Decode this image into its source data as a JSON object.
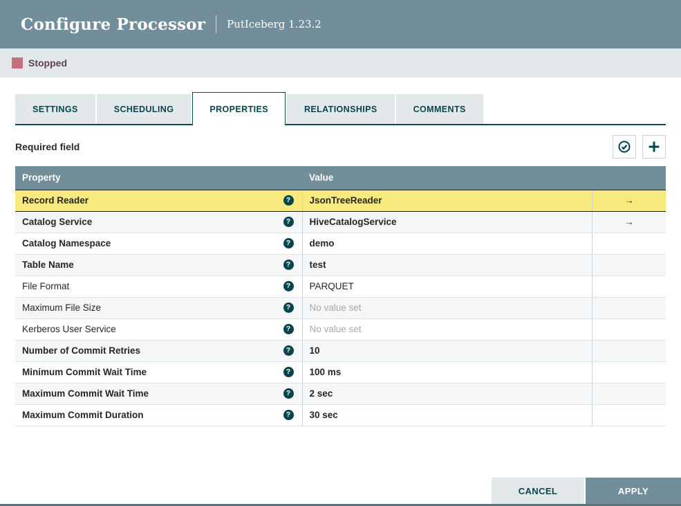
{
  "header": {
    "title": "Configure Processor",
    "subtitle": "PutIceberg 1.23.2"
  },
  "status": {
    "label": "Stopped",
    "color": "#c5707c"
  },
  "tabs": [
    {
      "label": "SETTINGS",
      "active": false
    },
    {
      "label": "SCHEDULING",
      "active": false
    },
    {
      "label": "PROPERTIES",
      "active": true
    },
    {
      "label": "RELATIONSHIPS",
      "active": false
    },
    {
      "label": "COMMENTS",
      "active": false
    }
  ],
  "toolbar": {
    "required_label": "Required field",
    "verify_icon": "check-circle-icon",
    "add_icon": "plus-icon"
  },
  "table": {
    "columns": [
      "Property",
      "Value"
    ],
    "help_icon_glyph": "?",
    "goto_arrow_glyph": "→",
    "rows": [
      {
        "property": "Record Reader",
        "value": "JsonTreeReader",
        "required": true,
        "selected": true,
        "goto": true,
        "no_value": false
      },
      {
        "property": "Catalog Service",
        "value": "HiveCatalogService",
        "required": true,
        "selected": false,
        "goto": true,
        "no_value": false
      },
      {
        "property": "Catalog Namespace",
        "value": "demo",
        "required": true,
        "selected": false,
        "goto": false,
        "no_value": false
      },
      {
        "property": "Table Name",
        "value": "test",
        "required": true,
        "selected": false,
        "goto": false,
        "no_value": false
      },
      {
        "property": "File Format",
        "value": "PARQUET",
        "required": false,
        "selected": false,
        "goto": false,
        "no_value": false
      },
      {
        "property": "Maximum File Size",
        "value": "No value set",
        "required": false,
        "selected": false,
        "goto": false,
        "no_value": true
      },
      {
        "property": "Kerberos User Service",
        "value": "No value set",
        "required": false,
        "selected": false,
        "goto": false,
        "no_value": true
      },
      {
        "property": "Number of Commit Retries",
        "value": "10",
        "required": true,
        "selected": false,
        "goto": false,
        "no_value": false
      },
      {
        "property": "Minimum Commit Wait Time",
        "value": "100 ms",
        "required": true,
        "selected": false,
        "goto": false,
        "no_value": false
      },
      {
        "property": "Maximum Commit Wait Time",
        "value": "2 sec",
        "required": true,
        "selected": false,
        "goto": false,
        "no_value": false
      },
      {
        "property": "Maximum Commit Duration",
        "value": "30 sec",
        "required": true,
        "selected": false,
        "goto": false,
        "no_value": false
      }
    ]
  },
  "footer": {
    "cancel_label": "CANCEL",
    "apply_label": "APPLY"
  },
  "colors": {
    "header_bg": "#728e9b",
    "statusbar_bg": "#e3e8eb",
    "accent_teal": "#07454d",
    "selected_row": "#f7e97e",
    "alt_row": "#f4f6f7",
    "stopped_square": "#c5707c"
  }
}
